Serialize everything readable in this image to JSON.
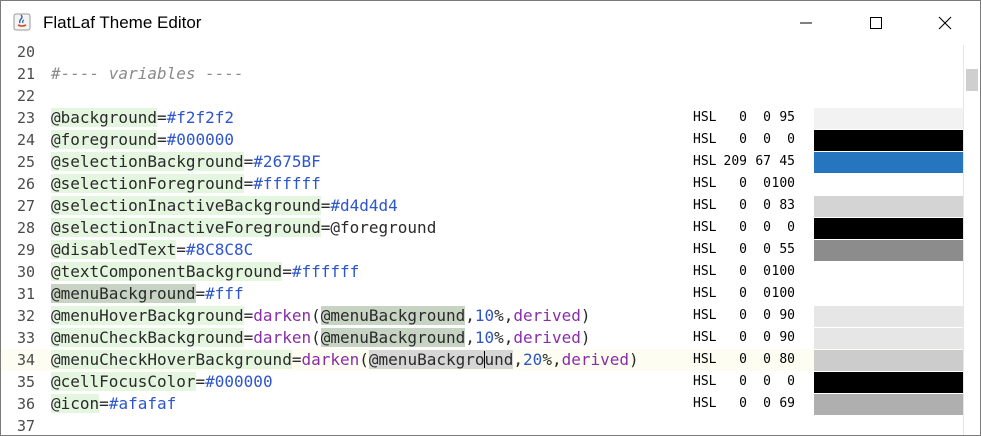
{
  "window": {
    "title": "FlatLaf Theme Editor",
    "app_icon": "java-icon",
    "controls": [
      "minimize-icon",
      "maximize-icon",
      "close-icon"
    ]
  },
  "editor": {
    "lines": [
      {
        "num": "20",
        "kind": "blank"
      },
      {
        "num": "21",
        "kind": "comment",
        "text": "#---- variables ----"
      },
      {
        "num": "22",
        "kind": "blank"
      },
      {
        "num": "23",
        "kind": "prop",
        "var": "@background",
        "eq": "=",
        "parts": [
          {
            "t": "#f2f2f2",
            "c": "v"
          }
        ],
        "hsl": [
          "HSL",
          "0",
          "0",
          "95"
        ],
        "swatch": "#f2f2f2"
      },
      {
        "num": "24",
        "kind": "prop",
        "var": "@foreground",
        "eq": "=",
        "parts": [
          {
            "t": "#000000",
            "c": "v"
          }
        ],
        "hsl": [
          "HSL",
          "0",
          "0",
          "0"
        ],
        "swatch": "#000000"
      },
      {
        "num": "25",
        "kind": "prop",
        "var": "@selectionBackground",
        "eq": "=",
        "parts": [
          {
            "t": "#2675BF",
            "c": "v"
          }
        ],
        "hsl": [
          "HSL",
          "209",
          "67",
          "45"
        ],
        "swatch": "#2675BF"
      },
      {
        "num": "26",
        "kind": "prop",
        "var": "@selectionForeground",
        "eq": "=",
        "parts": [
          {
            "t": "#ffffff",
            "c": "v"
          }
        ],
        "hsl": [
          "HSL",
          "0",
          "0",
          "100"
        ],
        "swatch": "#ffffff"
      },
      {
        "num": "27",
        "kind": "prop",
        "var": "@selectionInactiveBackground",
        "eq": "=",
        "parts": [
          {
            "t": "#d4d4d4",
            "c": "v"
          }
        ],
        "hsl": [
          "HSL",
          "0",
          "0",
          "83"
        ],
        "swatch": "#d4d4d4"
      },
      {
        "num": "28",
        "kind": "prop",
        "var": "@selectionInactiveForeground",
        "eq": "=",
        "parts": [
          {
            "t": "@foreground",
            "c": "k"
          }
        ],
        "hsl": [
          "HSL",
          "0",
          "0",
          "0"
        ],
        "swatch": "#000000"
      },
      {
        "num": "29",
        "kind": "prop",
        "var": "@disabledText",
        "eq": "=",
        "parts": [
          {
            "t": "#8C8C8C",
            "c": "v"
          }
        ],
        "hsl": [
          "HSL",
          "0",
          "0",
          "55"
        ],
        "swatch": "#8C8C8C"
      },
      {
        "num": "30",
        "kind": "prop",
        "var": "@textComponentBackground",
        "eq": "=",
        "parts": [
          {
            "t": "#ffffff",
            "c": "v"
          }
        ],
        "hsl": [
          "HSL",
          "0",
          "0",
          "100"
        ],
        "swatch": "#ffffff"
      },
      {
        "num": "31",
        "kind": "prop",
        "var": "@menuBackground",
        "varClass": "ref",
        "eq": "=",
        "parts": [
          {
            "t": "#fff",
            "c": "v"
          }
        ],
        "hsl": [
          "HSL",
          "0",
          "0",
          "100"
        ],
        "swatch": "#ffffff"
      },
      {
        "num": "32",
        "kind": "prop",
        "var": "@menuHoverBackground",
        "eq": "=",
        "parts": [
          {
            "t": "darken",
            "c": "f"
          },
          {
            "t": "(",
            "c": "k"
          },
          {
            "t": "@menuBackground",
            "c": "k ref"
          },
          {
            "t": ",",
            "c": "k"
          },
          {
            "t": "10",
            "c": "num"
          },
          {
            "t": "%,",
            "c": "k"
          },
          {
            "t": "derived",
            "c": "f"
          },
          {
            "t": ")",
            "c": "k"
          }
        ],
        "hsl": [
          "HSL",
          "0",
          "0",
          "90"
        ],
        "swatch": "#e6e6e6"
      },
      {
        "num": "33",
        "kind": "prop",
        "var": "@menuCheckBackground",
        "eq": "=",
        "parts": [
          {
            "t": "darken",
            "c": "f"
          },
          {
            "t": "(",
            "c": "k"
          },
          {
            "t": "@menuBackground",
            "c": "k ref"
          },
          {
            "t": ",",
            "c": "k"
          },
          {
            "t": "10",
            "c": "num"
          },
          {
            "t": "%,",
            "c": "k"
          },
          {
            "t": "derived",
            "c": "f"
          },
          {
            "t": ")",
            "c": "k"
          }
        ],
        "hsl": [
          "HSL",
          "0",
          "0",
          "90"
        ],
        "swatch": "#e6e6e6"
      },
      {
        "num": "34",
        "kind": "prop",
        "current": true,
        "var": "@menuCheckHoverBackground",
        "eq": "=",
        "parts": [
          {
            "t": "darken",
            "c": "f"
          },
          {
            "t": "(",
            "c": "k"
          },
          {
            "t": "@menuBackgro",
            "c": "k refhl"
          },
          {
            "t": "|",
            "c": "caret"
          },
          {
            "t": "und",
            "c": "k refhl"
          },
          {
            "t": ",",
            "c": "k"
          },
          {
            "t": "20",
            "c": "num"
          },
          {
            "t": "%,",
            "c": "k"
          },
          {
            "t": "derived",
            "c": "f"
          },
          {
            "t": ")",
            "c": "k"
          }
        ],
        "hsl": [
          "HSL",
          "0",
          "0",
          "80"
        ],
        "swatch": "#cccccc"
      },
      {
        "num": "35",
        "kind": "prop",
        "var": "@cellFocusColor",
        "eq": "=",
        "parts": [
          {
            "t": "#000000",
            "c": "v"
          }
        ],
        "hsl": [
          "HSL",
          "0",
          "0",
          "0"
        ],
        "swatch": "#000000"
      },
      {
        "num": "36",
        "kind": "prop",
        "var": "@icon",
        "eq": "=",
        "parts": [
          {
            "t": "#afafaf",
            "c": "v"
          }
        ],
        "hsl": [
          "HSL",
          "0",
          "0",
          "69"
        ],
        "swatch": "#afafaf"
      },
      {
        "num": "37",
        "kind": "blank"
      }
    ]
  }
}
